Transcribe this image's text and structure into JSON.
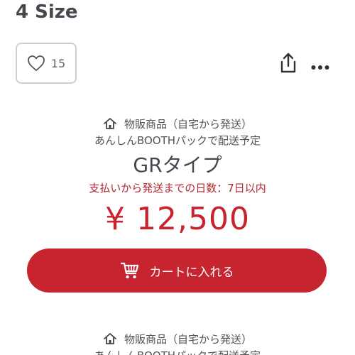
{
  "item": {
    "title": "4 Size"
  },
  "actions": {
    "like_count": "15",
    "share_icon": "share-icon",
    "more_icon": "more-icon"
  },
  "variants": [
    {
      "ship_type": "物販商品（自宅から発送）",
      "ship_pack": "あんしんBOOTHパックで配送予定",
      "name": "GRタイプ",
      "shipping_days": "支払いから発送までの日数：7日以内",
      "price": "¥ 12,500",
      "cart_label": "カートに入れる"
    },
    {
      "ship_type": "物販商品（自宅から発送）",
      "ship_pack": "あんしんBOOTHパックで配送予定"
    }
  ],
  "colors": {
    "accent": "#c6252f",
    "price": "#c8242f",
    "notice": "#b2262f",
    "text": "#45494f"
  }
}
